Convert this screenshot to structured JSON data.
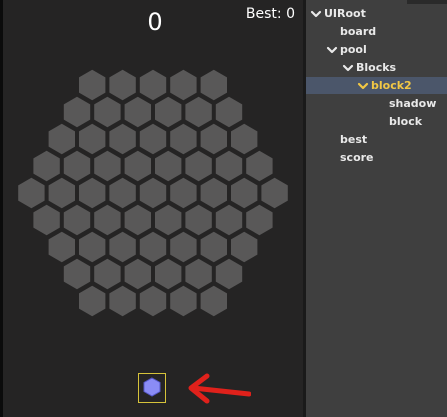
{
  "game": {
    "score": "0",
    "best_label": "Best: 0",
    "rows": [
      5,
      6,
      7,
      8,
      9,
      8,
      7,
      6,
      5
    ],
    "board_color": "#595858",
    "background_color": "#252424",
    "piece_color": "#8a8cf5",
    "selection_color": "#d6c33a",
    "arrow_color": "#e0211b"
  },
  "hierarchy": {
    "root": "UIRoot",
    "board": "board",
    "pool": "pool",
    "blocks": "Blocks",
    "block2": "block2",
    "shadow": "shadow",
    "block": "block",
    "best": "best",
    "score": "score"
  }
}
